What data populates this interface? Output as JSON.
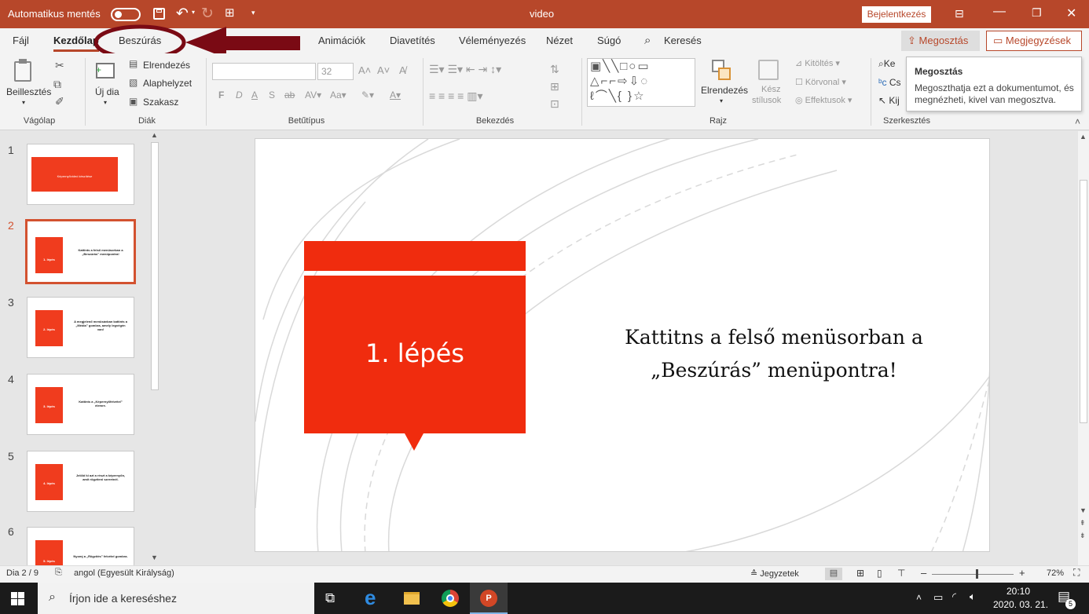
{
  "titlebar": {
    "autosave_label": "Automatikus mentés",
    "doc_title": "video",
    "signin": "Bejelentkezés"
  },
  "tabs": [
    "Fájl",
    "Kezdőlap",
    "Beszúrás",
    "Animációk",
    "Diavetítés",
    "Véleményezés",
    "Nézet",
    "Súgó",
    "Keresés"
  ],
  "share": {
    "label": "Megosztás",
    "comments": "Megjegyzések"
  },
  "ribbon": {
    "clipboard": {
      "paste": "Beillesztés",
      "group": "Vágólap"
    },
    "slides": {
      "new": "Új dia",
      "layout": "Elrendezés",
      "reset": "Alaphelyzet",
      "section": "Szakasz",
      "group": "Diák"
    },
    "font": {
      "size": "32",
      "group": "Betűtípus",
      "bold": "F",
      "italic": "D",
      "underline": "A",
      "shadow": "S"
    },
    "paragraph": {
      "group": "Bekezdés"
    },
    "drawing": {
      "arrange": "Elrendezés",
      "quick_styles_1": "Kész",
      "quick_styles_2": "stílusok",
      "fill": "Kitöltés",
      "outline": "Körvonal",
      "effects": "Effektusok",
      "group": "Rajz"
    },
    "editing": {
      "find": "Ke",
      "replace": "Cs",
      "select": "Kij",
      "group": "Szerkesztés"
    }
  },
  "tooltip": {
    "title": "Megosztás",
    "body": "Megoszthatja ezt a dokumentumot, és megnézheti, kivel van megosztva."
  },
  "thumbnails": [
    {
      "num": "1",
      "text": "Képernyővideó készítése"
    },
    {
      "num": "2",
      "text": "Kattints a felső menüsorban a „Beszúrás” menüpontra!",
      "box": "1. lépés"
    },
    {
      "num": "3",
      "text": "A megjelenő menüsávban kattints a „Média” gombra, amely legvégén van!",
      "box": "2. lépés"
    },
    {
      "num": "4",
      "text": "Kattints a „Képernyőfelvétel” elemre.",
      "box": "3. lépés"
    },
    {
      "num": "5",
      "text": "Jelöld ki azt a részt a képernyőn, amit rögzíteni szeretnél.",
      "box": "4. lépés"
    },
    {
      "num": "6",
      "text": "Nyomj a „Rögzítés” felvétel gombra.",
      "box": "5. lépés"
    }
  ],
  "slide": {
    "box_label": "1. lépés",
    "line1": "Kattitns a felső menüsorban a",
    "line2": "„Beszúrás” menüpontra!"
  },
  "status": {
    "slide": "Dia 2 / 9",
    "lang": "angol (Egyesült Királyság)",
    "notes": "Jegyzetek",
    "zoom": "72%"
  },
  "taskbar": {
    "search": "Írjon ide a kereséshez",
    "time": "20:10",
    "date": "2020. 03. 21.",
    "notif": "5"
  },
  "colors": {
    "accent": "#b7472a",
    "slide_red": "#f03c1e",
    "annotation": "#7a0a14"
  }
}
